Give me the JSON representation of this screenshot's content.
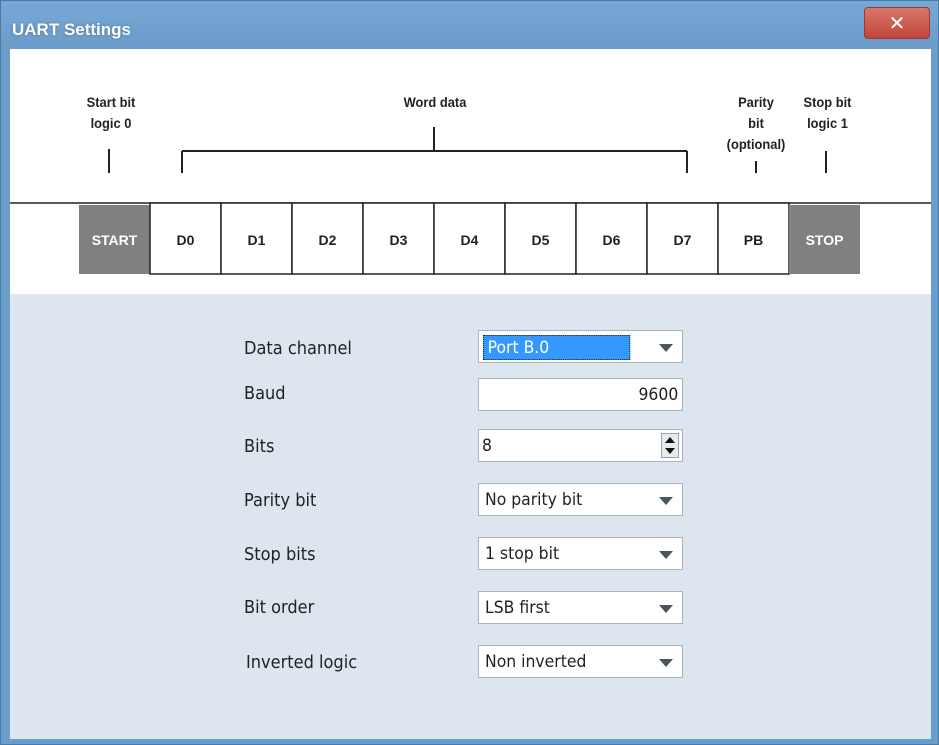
{
  "window": {
    "title": "UART Settings"
  },
  "diagram": {
    "labels": {
      "start": "Start bit\nlogic 0",
      "word": "Word data",
      "parity": "Parity\nbit\n(optional)",
      "stop": "Stop bit\nlogic 1"
    },
    "cells": [
      "START",
      "D0",
      "D1",
      "D2",
      "D3",
      "D4",
      "D5",
      "D6",
      "D7",
      "PB",
      "STOP"
    ]
  },
  "form": {
    "data_channel": {
      "label": "Data channel",
      "value": "Port B.0"
    },
    "baud": {
      "label": "Baud",
      "value": "9600"
    },
    "bits": {
      "label": "Bits",
      "value": "8"
    },
    "parity": {
      "label": "Parity bit",
      "value": "No parity bit"
    },
    "stop_bits": {
      "label": "Stop bits",
      "value": "1 stop bit"
    },
    "bit_order": {
      "label": "Bit order",
      "value": "LSB first"
    },
    "inverted": {
      "label": "Inverted logic",
      "value": "Non inverted"
    }
  },
  "colors": {
    "title_bar": "#6b9dca",
    "selection": "#3399ff",
    "form_bg": "#dde5ee",
    "start_stop_cell": "#808080"
  },
  "icons": {
    "close": "close-icon",
    "dropdown": "chevron-down-icon",
    "spinner": "spinner-icon"
  }
}
